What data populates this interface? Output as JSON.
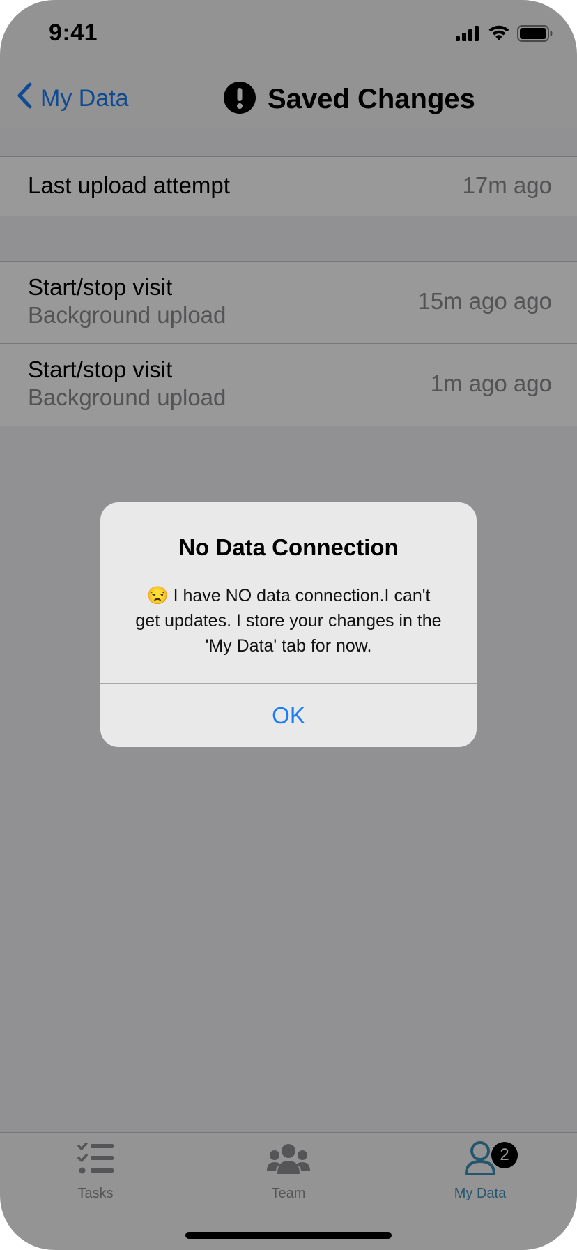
{
  "status_bar": {
    "time": "9:41",
    "icons": [
      "signal-icon",
      "wifi-icon",
      "battery-icon"
    ]
  },
  "nav": {
    "back_label": "My Data",
    "title": "Saved Changes",
    "title_icon": "exclamation-icon"
  },
  "list": {
    "last_upload": {
      "label": "Last upload attempt",
      "value": "17m ago"
    },
    "items": [
      {
        "title": "Start/stop visit",
        "subtitle": "Background upload",
        "time": "15m ago ago"
      },
      {
        "title": "Start/stop visit",
        "subtitle": "Background upload",
        "time": "1m ago ago"
      }
    ]
  },
  "alert": {
    "title": "No Data Connection",
    "emoji": "😒",
    "message": " I have NO data connection.I can't get updates. I store your changes in the 'My Data' tab for now.",
    "ok_label": "OK"
  },
  "tabs": [
    {
      "label": "Tasks",
      "icon": "tasks-list-icon",
      "active": false
    },
    {
      "label": "Team",
      "icon": "team-icon",
      "active": false
    },
    {
      "label": "My Data",
      "icon": "user-icon",
      "active": true,
      "badge": "2"
    }
  ],
  "colors": {
    "accent": "#1a7cf6",
    "active_tab": "#3f8fb8",
    "badge": "#000000"
  }
}
